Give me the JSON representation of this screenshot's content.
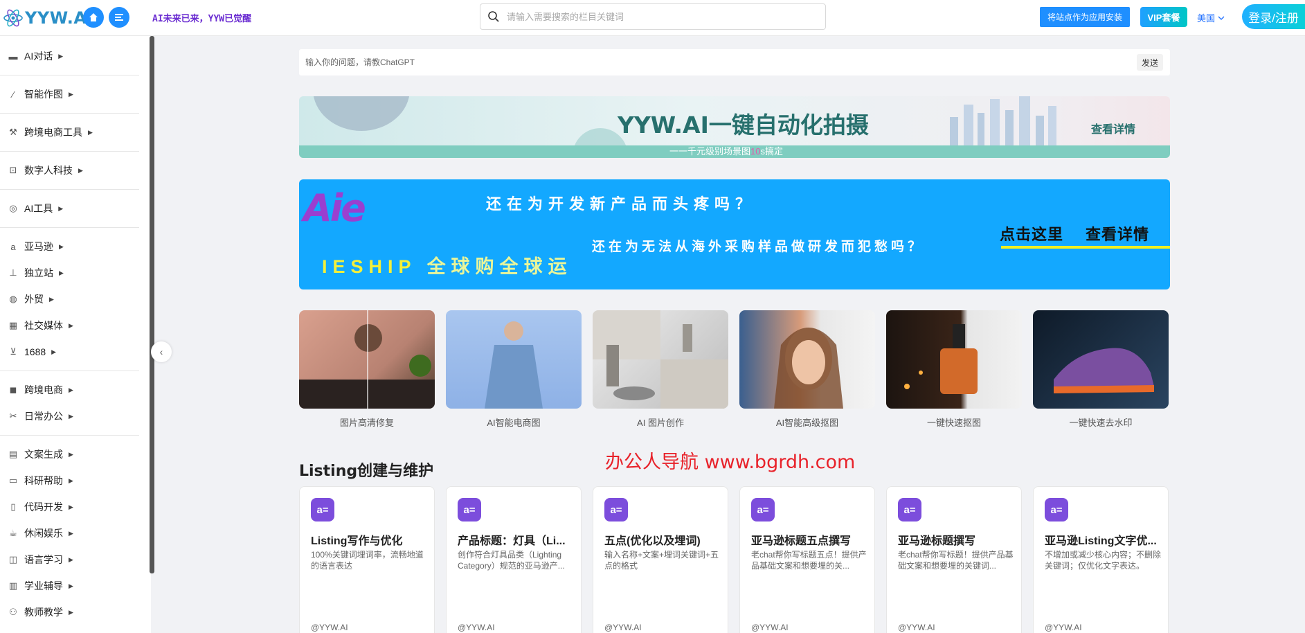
{
  "header": {
    "logo_text": "YYW.AI",
    "slogan": "AI未来已来，YYW已觉醒",
    "search_placeholder": "请输入需要搜索的栏目关键词",
    "install_label": "将站点作为应用安装",
    "vip_label": "VIP套餐",
    "region_label": "美国",
    "login_label": "登录/注册"
  },
  "sidebar": {
    "items": [
      {
        "label": "AI对话",
        "icon": "chat-icon"
      },
      {
        "label": "智能作图",
        "icon": "magic-wand-icon"
      },
      {
        "label": "跨境电商工具",
        "icon": "wrench-icon"
      },
      {
        "label": "数字人科技",
        "icon": "robot-icon"
      },
      {
        "label": "AI工具",
        "icon": "target-icon"
      },
      {
        "label": "亚马逊",
        "icon": "amazon-icon"
      },
      {
        "label": "独立站",
        "icon": "sitemap-icon"
      },
      {
        "label": "外贸",
        "icon": "globe-icon"
      },
      {
        "label": "社交媒体",
        "icon": "dashboard-icon"
      },
      {
        "label": "1688",
        "icon": "cart-icon"
      },
      {
        "label": "跨境电商",
        "icon": "bag-icon"
      },
      {
        "label": "日常办公",
        "icon": "scissors-icon"
      },
      {
        "label": "文案生成",
        "icon": "document-icon"
      },
      {
        "label": "科研帮助",
        "icon": "calendar-icon"
      },
      {
        "label": "代码开发",
        "icon": "phone-icon"
      },
      {
        "label": "休闲娱乐",
        "icon": "coffee-icon"
      },
      {
        "label": "语言学习",
        "icon": "book-icon"
      },
      {
        "label": "学业辅导",
        "icon": "chart-icon"
      },
      {
        "label": "教师教学",
        "icon": "users-icon"
      }
    ]
  },
  "chat": {
    "placeholder": "输入你的问题，请教ChatGPT",
    "send_label": "发送"
  },
  "banner1": {
    "title": "YYW.AI一键自动化拍摄",
    "subtitle_pre": "一一千元级别场景图",
    "subtitle_hl": "10",
    "subtitle_post": "s搞定",
    "more": "查看详情"
  },
  "banner2": {
    "logo": "Aie",
    "question1": "还在为开发新产品而头疼吗？",
    "question2": "还在为无法从海外采购样品做研发而犯愁吗？",
    "brand": "IESHIP",
    "brand_slogan": "全球购全球运",
    "cta1": "点击这里",
    "cta2": "查看详情"
  },
  "image_tools": [
    {
      "label": "图片高清修复",
      "color": "#c79a8a"
    },
    {
      "label": "AI智能电商图",
      "color": "#8fb4e2"
    },
    {
      "label": "AI 图片创作",
      "color": "#cfcfcf"
    },
    {
      "label": "AI智能高级抠图",
      "color": "#c7a88f"
    },
    {
      "label": "一键快速抠图",
      "color": "#5a3a2a"
    },
    {
      "label": "一键快速去水印",
      "color": "#2a3a4a"
    }
  ],
  "section": {
    "title": "Listing创建与维护",
    "watermark": "办公人导航 www.bgrdh.com"
  },
  "tool_cards": [
    {
      "name": "Listing写作与优化",
      "desc": "100%关键词埋词率，流畅地道的语言表达",
      "author": "@YYW.AI"
    },
    {
      "name": "产品标题：灯具（Li...",
      "desc": "创作符合灯具品类（Lighting Category）规范的亚马逊产...",
      "author": "@YYW.AI"
    },
    {
      "name": "五点(优化以及埋词)",
      "desc": "输入名称+文案+埋词关键词+五点的格式",
      "author": "@YYW.AI"
    },
    {
      "name": "亚马逊标题五点撰写",
      "desc": "老chat帮你写标题五点！提供产品基础文案和想要埋的关...",
      "author": "@YYW.AI"
    },
    {
      "name": "亚马逊标题撰写",
      "desc": "老chat帮你写标题！提供产品基础文案和想要埋的关键词...",
      "author": "@YYW.AI"
    },
    {
      "name": "亚马逊Listing文字优...",
      "desc": "不增加或减少核心内容；不删除关键词；仅优化文字表达。",
      "author": "@YYW.AI"
    }
  ]
}
